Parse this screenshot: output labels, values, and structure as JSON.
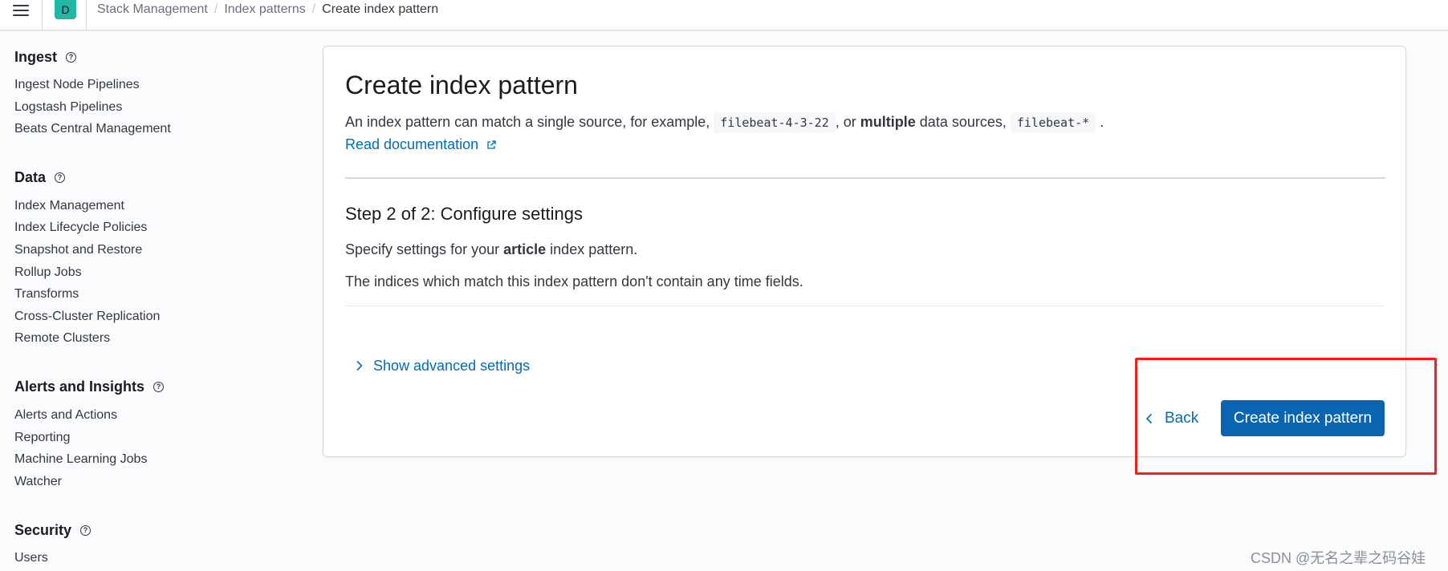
{
  "header": {
    "space_initial": "D",
    "breadcrumbs": [
      "Stack Management",
      "Index patterns",
      "Create index pattern"
    ]
  },
  "sidebar": {
    "sections": [
      {
        "title": "Ingest",
        "items": [
          "Ingest Node Pipelines",
          "Logstash Pipelines",
          "Beats Central Management"
        ]
      },
      {
        "title": "Data",
        "items": [
          "Index Management",
          "Index Lifecycle Policies",
          "Snapshot and Restore",
          "Rollup Jobs",
          "Transforms",
          "Cross-Cluster Replication",
          "Remote Clusters"
        ]
      },
      {
        "title": "Alerts and Insights",
        "items": [
          "Alerts and Actions",
          "Reporting",
          "Machine Learning Jobs",
          "Watcher"
        ]
      },
      {
        "title": "Security",
        "items": [
          "Users"
        ]
      }
    ]
  },
  "main": {
    "title": "Create index pattern",
    "description": {
      "part1": "An index pattern can match a single source, for example,",
      "code1": "filebeat-4-3-22",
      "part2": ", or",
      "bold": "multiple",
      "part3": "data sources,",
      "code2": "filebeat-*",
      "part4": "."
    },
    "doc_link": "Read documentation",
    "step_title": "Step 2 of 2: Configure settings",
    "settings_text_prefix": "Specify settings for your",
    "index_name": "article",
    "settings_text_suffix": "index pattern.",
    "no_time_fields": "The indices which match this index pattern don't contain any time fields.",
    "advanced_toggle": "Show advanced settings",
    "back_label": "Back",
    "create_label": "Create index pattern"
  },
  "watermark": "CSDN @无名之辈之码谷娃",
  "colors": {
    "accent": "#006bb8",
    "primary_button": "#0b64b0",
    "avatar": "#20b8a5",
    "highlight": "#ff1a1a"
  }
}
